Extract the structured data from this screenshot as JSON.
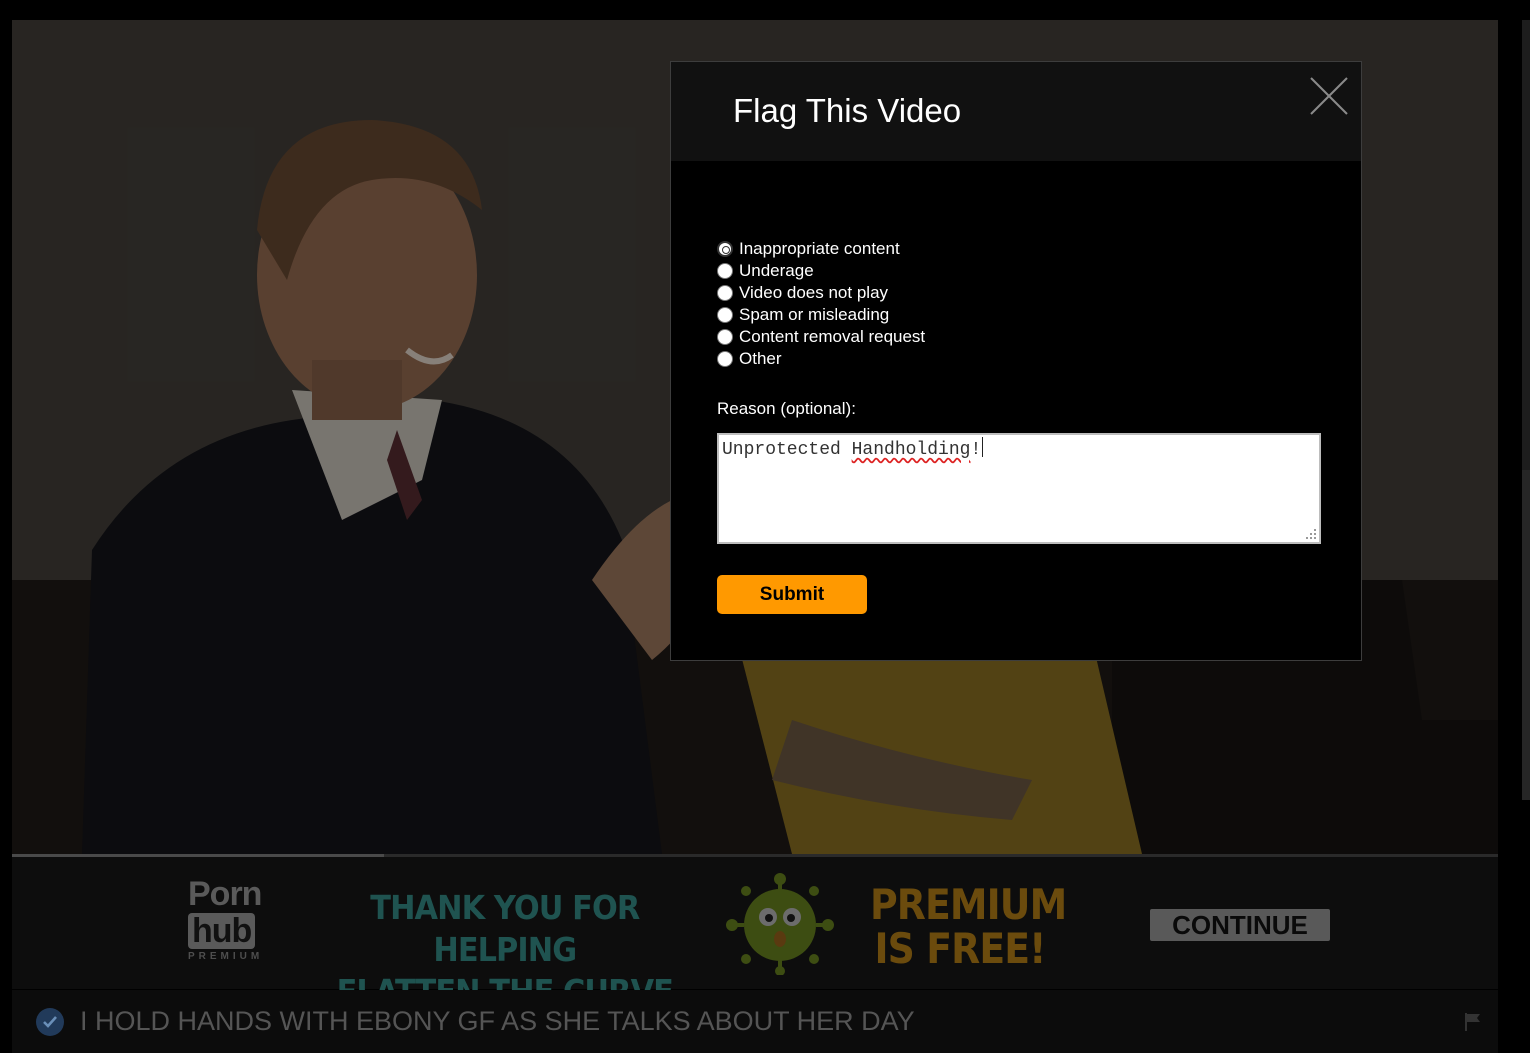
{
  "modal": {
    "title": "Flag This Video",
    "options": [
      {
        "label": "Inappropriate content",
        "selected": true
      },
      {
        "label": "Underage",
        "selected": false
      },
      {
        "label": "Video does not play",
        "selected": false
      },
      {
        "label": "Spam or misleading",
        "selected": false
      },
      {
        "label": "Content removal request",
        "selected": false
      },
      {
        "label": "Other",
        "selected": false
      }
    ],
    "reason_label": "Reason (optional):",
    "reason_value_part1": "Unprotected ",
    "reason_value_misspelled": "Handholding",
    "reason_value_part2": "!",
    "submit_label": "Submit"
  },
  "banner": {
    "logo_top": "Porn",
    "logo_bottom": "hub",
    "logo_sub": "PREMIUM",
    "message_line1": "THANK YOU FOR HELPING",
    "message_line2": "FLATTEN THE CURVE",
    "promo_line1": "PREMIUM",
    "promo_line2": "IS FREE!",
    "continue_label": "CONTINUE"
  },
  "video": {
    "title": "I HOLD HANDS WITH EBONY GF AS SHE TALKS ABOUT HER DAY",
    "progress_percent": 25
  },
  "colors": {
    "submit": "#ff9900",
    "overlay_header": "#111111",
    "verified": "#213a5a"
  },
  "icons": [
    "close-icon",
    "verified-check-icon",
    "flag-icon",
    "resize-grip-icon",
    "virus-mascot-icon"
  ]
}
